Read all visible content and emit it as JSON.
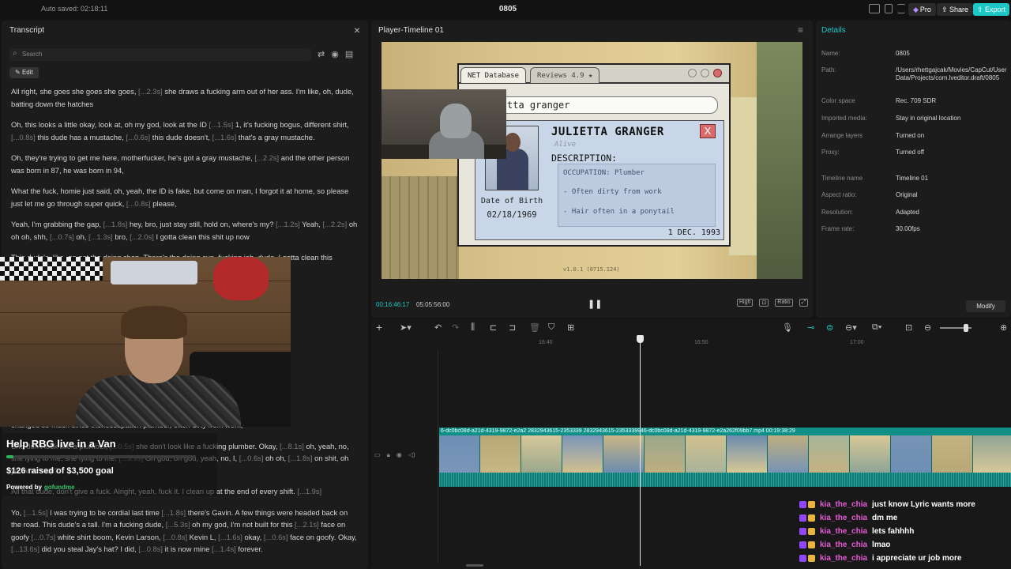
{
  "topbar": {
    "autosave": "Auto saved: 02:18:11",
    "title": "0805",
    "pro_label": "Pro",
    "share_label": "Share",
    "export_label": "Export"
  },
  "transcript": {
    "title": "Transcript",
    "search_placeholder": "Search",
    "edit_label": "Edit",
    "paragraphs": [
      {
        "text": "All right, she goes she goes she goes, [...2.3s] she draws a fucking arm out of her ass. I'm like, oh, dude, batting down the hatches"
      },
      {
        "text": "Oh, this looks a little okay, look at, oh my god, look at the ID [...1.5s] 1, it's fucking bogus, different shirt, [...0.8s] this dude has a mustache, [...0.6s] this dude doesn't, [...1.6s] that's a gray mustache."
      },
      {
        "text": "Oh, they're trying to get me here, motherfucker, he's got a gray mustache, [...2.2s] and the other person was born in 87, he was born in 94,"
      },
      {
        "text": "What the fuck, homie just said, oh, yeah, the ID is fake, but come on man, I forgot it at home, so please just let me go through super quick, [...0.8s] please,"
      },
      {
        "text": "Yeah, I'm grabbing the gap, [...1.8s] hey, bro, just stay still, hold on, where's my? [...1.2s] Yeah, [...2.2s] oh oh oh, shh, [...0.7s] oh, [...1.3s] bro, [...2.0s] I gotta clean this shit up now"
      },
      {
        "text": "This dude's, like, go get the doing shop. There's the doing cup, fucking job, dude, I gotta clean this"
      },
      {
        "text": "d I could never run a"
      },
      {
        "text": "start, I really need a"
      },
      {
        "text": "like, an option."
      },
      {
        "text": "okay,"
      },
      {
        "text": "Oh, [...6.0s]"
      },
      {
        "text": "hooting?"
      },
      {
        "text": "photo. Ugh, I've"
      },
      {
        "text": "changed so much since thenoccupation plumber, often dirty from work,"
      },
      {
        "text": "She don't look like a plumber, [...0.5s] she don't look like a fucking plumber. Okay, [...8.1s] oh, yeah, no, she lying to me, she lying to me. [...3.9s] Oh god, oh god, yeah, no, I, [...0.6s] oh oh, [...1.8s] on shit, oh yo, what's up?"
      },
      {
        "text": "All that dude, don't give a fuck. Alright, yeah, fuck it. I clean up at the end of every shift. [...1.9s]"
      },
      {
        "text": "Yo, [...1.5s] I was trying to be cordial last time [...1.8s] there's Gavin. A few things were headed back on the road. This dude's a tall. I'm a fucking dude, [...5.3s] oh my god, I'm not built for this [...2.1s] face on goofy [...0.7s] white shirt boom, Kevin Larson, [...0.8s] Kevin L, [...1.6s] okay, [...0.6s] face on goofy. Okay, [...13.6s] did you steal Jay's hat? I did, [...0.8s] it is now mine [...1.4s] forever."
      }
    ]
  },
  "donation": {
    "title": "Help RBG live in a Van",
    "raised": "$126 raised of $3,500 goal",
    "progress_fraction": 0.036,
    "powered_by": "Powered by",
    "brand": "gofundme"
  },
  "player": {
    "title": "Player-Timeline 01",
    "current_time": "00:16:46:17",
    "duration": "05:05:56:00",
    "quality_label": "High",
    "ratio_label": "Ratio",
    "game": {
      "tab1": "NET Database",
      "tab2": "Reviews 4.9 ★",
      "search_text": "tta granger",
      "name": "JULIETTA GRANGER",
      "status": "Alive",
      "description_label": "DESCRIPTION:",
      "desc_lines": [
        "OCCUPATION: Plumber",
        "- Often dirty from work",
        "- Hair often in a ponytail"
      ],
      "dob_label": "Date of Birth",
      "dob": "02/18/1969",
      "date": "1 DEC. 1993",
      "footer": "v1.0.1 (0715.124)"
    }
  },
  "details": {
    "title": "Details",
    "rows": [
      {
        "label": "Name:",
        "value": "0805"
      },
      {
        "label": "Path:",
        "value": "/Users/rhettgajcak/Movies/CapCut/User Data/Projects/com.lveditor.draft/0805"
      },
      {
        "label": "Color space",
        "value": "Rec. 709 SDR"
      },
      {
        "label": "Imported media:",
        "value": "Stay in original location"
      },
      {
        "label": "Arrange layers",
        "value": "Turned on"
      },
      {
        "label": "Proxy:",
        "value": "Turned off"
      },
      {
        "label": "Timeline name",
        "value": "Timeline 01"
      },
      {
        "label": "Aspect ratio:",
        "value": "Original"
      },
      {
        "label": "Resolution:",
        "value": "Adapted"
      },
      {
        "label": "Frame rate:",
        "value": "30.00fps"
      }
    ],
    "modify_label": "Modify"
  },
  "timeline": {
    "ruler": [
      "16:40",
      "16:50",
      "17:00"
    ],
    "clip_label": "6-dc0bc08d-a21d-4319-9872-e2a2  2832943615-2353339  2832943615-2353339946-dc0bc08d-a21d-4319-9872-e2a262f09bb7.mp4   00:19:38:29"
  },
  "chat": {
    "messages": [
      {
        "user": "kia_the_chia",
        "text": "just know Lyric wants more"
      },
      {
        "user": "kia_the_chia",
        "text": "dm me"
      },
      {
        "user": "kia_the_chia",
        "text": "lets fahhhh"
      },
      {
        "user": "kia_the_chia",
        "text": "lmao"
      },
      {
        "user": "kia_the_chia",
        "text": "i appreciate ur job more"
      }
    ]
  },
  "colors": {
    "accent": "#1ec7c7",
    "clip": "#0f8f86",
    "chat_user": "#e65bd6"
  }
}
